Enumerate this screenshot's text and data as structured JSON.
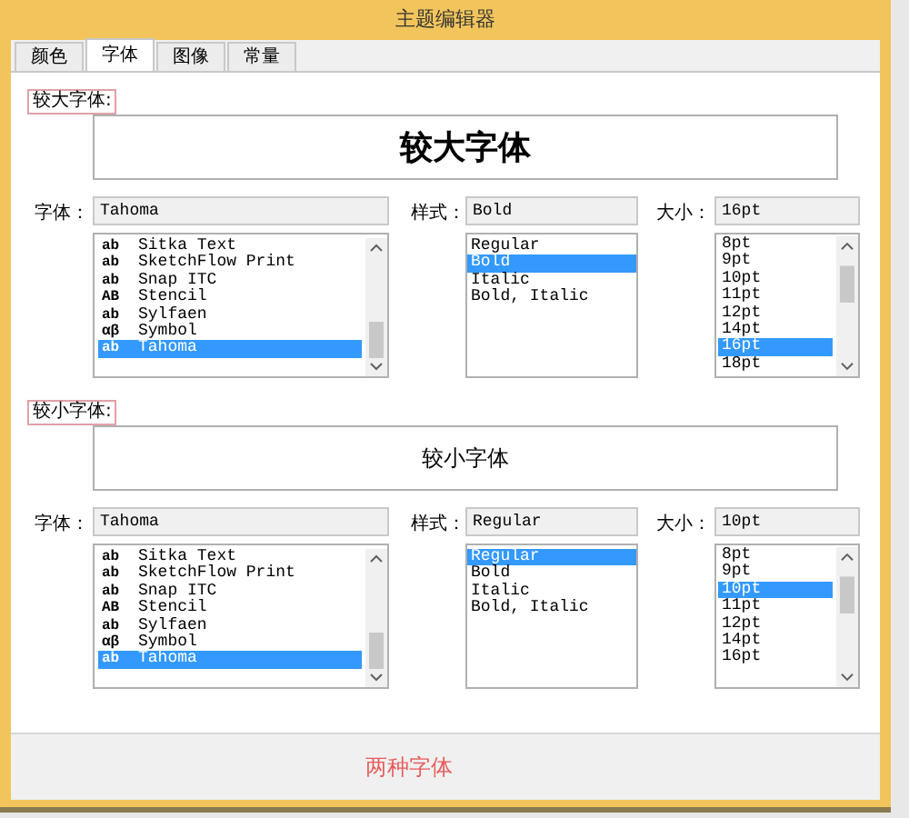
{
  "window": {
    "title": "主题编辑器"
  },
  "tabs": [
    {
      "label": "颜色",
      "selected": false
    },
    {
      "label": "字体",
      "selected": true
    },
    {
      "label": "图像",
      "selected": false
    },
    {
      "label": "常量",
      "selected": false
    }
  ],
  "sections": [
    {
      "label": "较大字体:",
      "preview": {
        "text": "较大字体",
        "bold": true
      },
      "font": {
        "label": "字体：",
        "value": "Tahoma",
        "items": [
          {
            "sample": "ab",
            "name": "Sitka Text",
            "selected": false
          },
          {
            "sample": "ab",
            "name": "SketchFlow Print",
            "selected": false
          },
          {
            "sample": "ab",
            "name": "Snap ITC",
            "selected": false
          },
          {
            "sample": "AB",
            "name": "Stencil",
            "selected": false
          },
          {
            "sample": "ab",
            "name": "Sylfaen",
            "selected": false
          },
          {
            "sample": "αβ",
            "name": "Symbol",
            "selected": false
          },
          {
            "sample": "ab",
            "name": "Tahoma",
            "selected": true
          }
        ]
      },
      "style": {
        "label": "样式：",
        "value": "Bold",
        "items": [
          {
            "name": "Regular",
            "selected": false
          },
          {
            "name": "Bold",
            "selected": true
          },
          {
            "name": "Italic",
            "selected": false
          },
          {
            "name": "Bold, Italic",
            "selected": false
          }
        ]
      },
      "size": {
        "label": "大小：",
        "value": "16pt",
        "items": [
          {
            "name": "8pt",
            "selected": false
          },
          {
            "name": "9pt",
            "selected": false
          },
          {
            "name": "10pt",
            "selected": false
          },
          {
            "name": "11pt",
            "selected": false
          },
          {
            "name": "12pt",
            "selected": false
          },
          {
            "name": "14pt",
            "selected": false
          },
          {
            "name": "16pt",
            "selected": true
          },
          {
            "name": "18pt",
            "selected": false
          }
        ]
      }
    },
    {
      "label": "较小字体:",
      "preview": {
        "text": "较小字体",
        "bold": false
      },
      "font": {
        "label": "字体：",
        "value": "Tahoma",
        "items": [
          {
            "sample": "ab",
            "name": "Sitka Text",
            "selected": false
          },
          {
            "sample": "ab",
            "name": "SketchFlow Print",
            "selected": false
          },
          {
            "sample": "ab",
            "name": "Snap ITC",
            "selected": false
          },
          {
            "sample": "AB",
            "name": "Stencil",
            "selected": false
          },
          {
            "sample": "ab",
            "name": "Sylfaen",
            "selected": false
          },
          {
            "sample": "αβ",
            "name": "Symbol",
            "selected": false
          },
          {
            "sample": "ab",
            "name": "Tahoma",
            "selected": true
          }
        ]
      },
      "style": {
        "label": "样式：",
        "value": "Regular",
        "items": [
          {
            "name": "Regular",
            "selected": true
          },
          {
            "name": "Bold",
            "selected": false
          },
          {
            "name": "Italic",
            "selected": false
          },
          {
            "name": "Bold, Italic",
            "selected": false
          }
        ]
      },
      "size": {
        "label": "大小：",
        "value": "10pt",
        "items": [
          {
            "name": "8pt",
            "selected": false
          },
          {
            "name": "9pt",
            "selected": false
          },
          {
            "name": "10pt",
            "selected": true
          },
          {
            "name": "11pt",
            "selected": false
          },
          {
            "name": "12pt",
            "selected": false
          },
          {
            "name": "14pt",
            "selected": false
          },
          {
            "name": "16pt",
            "selected": false
          }
        ]
      }
    }
  ],
  "footer": {
    "text": "两种字体"
  }
}
